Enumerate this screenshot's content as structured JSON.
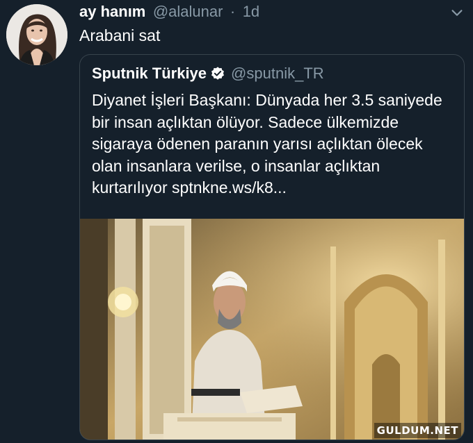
{
  "tweet": {
    "author_name": "ay hanım",
    "author_handle": "@alalunar",
    "separator": "·",
    "time": "1d",
    "text": "Arabani sat",
    "menu_icon": "chevron-down-icon"
  },
  "quoted_tweet": {
    "author_name": "Sputnik Türkiye",
    "verified_icon": "verified-badge-icon",
    "author_handle": "@sputnik_TR",
    "text": "Diyanet İşleri Başkanı: Dünyada her 3.5 saniyede bir insan açlıktan ölüyor. Sadece ülkemizde sigaraya ödenen paranın yarısı açlıktan ölecek olan insanlara verilse, o insanlar açlıktan kurtarılıyor sptnkne.ws/k8..."
  },
  "watermark": "GULDUM.NET",
  "colors": {
    "background": "#15202b",
    "border": "#38444d",
    "secondary_text": "#8899a6",
    "verified_blue": "#1da1f2"
  }
}
